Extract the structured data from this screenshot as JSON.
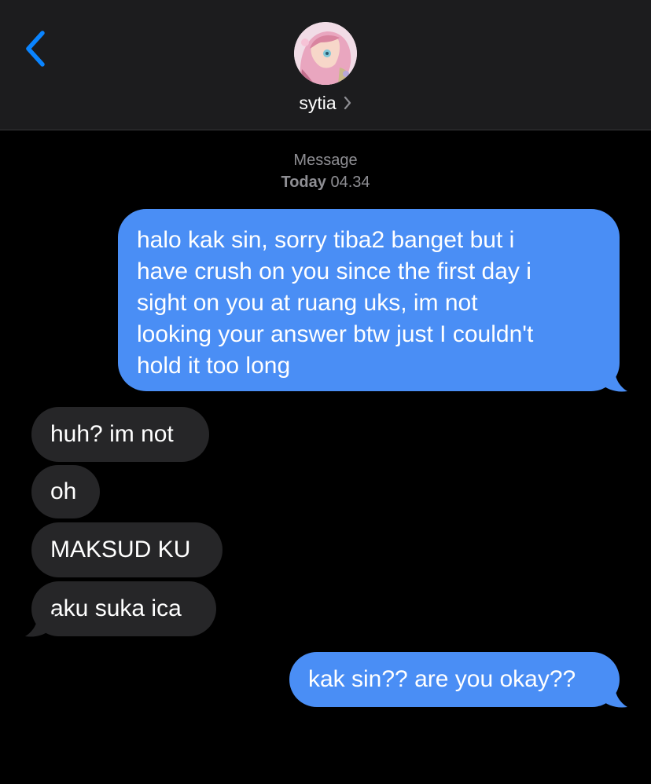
{
  "header": {
    "contact_name": "sytia",
    "back_icon": "chevron-left-icon",
    "chevron_icon": "chevron-right-icon",
    "accent_color": "#0a84ff"
  },
  "meta": {
    "service": "Message",
    "day": "Today",
    "time": "04.34"
  },
  "messages": [
    {
      "direction": "sent",
      "lines": [
        "halo kak sin, sorry tiba2 banget but i",
        "have crush on you since the first day i",
        "sight on you at ruang uks, im not",
        "looking your answer btw just I couldn't",
        "hold it too long"
      ]
    },
    {
      "direction": "received",
      "text": "huh? im not"
    },
    {
      "direction": "received",
      "text": "oh"
    },
    {
      "direction": "received",
      "text": "MAKSUD KU"
    },
    {
      "direction": "received",
      "text": "aku suka ica"
    },
    {
      "direction": "sent",
      "text": "kak sin?? are you okay??"
    }
  ],
  "colors": {
    "sent_bubble": "#4a8ef5",
    "received_bubble": "#262628",
    "background": "#000000",
    "header_bg": "#1c1c1e"
  }
}
